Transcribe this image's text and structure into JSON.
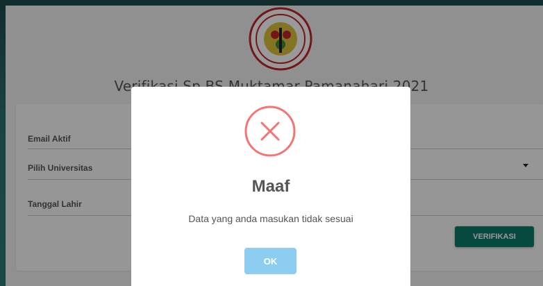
{
  "header": {
    "title": "Verifikasi Sp.BS Muktamar Pamanahari 2021"
  },
  "form": {
    "email_label": "Email Aktif",
    "university_label": "Pilih Universitas",
    "birthdate_label": "Tanggal Lahir",
    "verify_label": "VERIFIKASI"
  },
  "modal": {
    "title": "Maaf",
    "message": "Data yang anda masukan tidak sesuai",
    "ok_label": "OK"
  },
  "colors": {
    "primary_button": "#0a7c6c",
    "error_icon": "#f27474",
    "ok_button": "#8ccdf0"
  }
}
